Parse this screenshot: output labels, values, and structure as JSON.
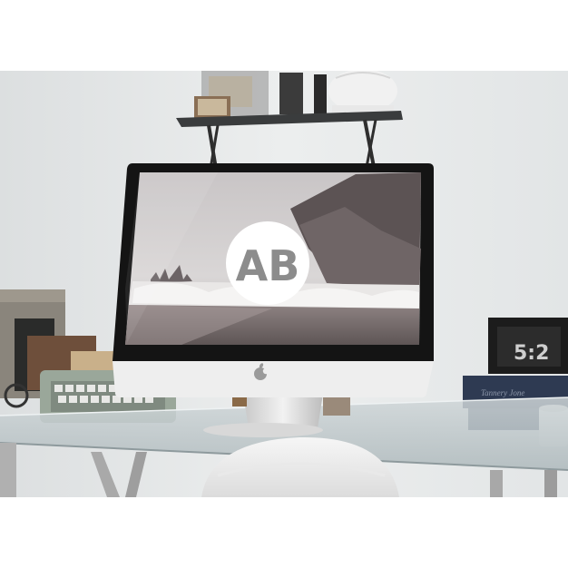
{
  "scene": {
    "description_tags": [
      "desk-photo",
      "imac-mockup"
    ],
    "screen_logo_text": "AB",
    "book_spine_text": "Tannery Jone",
    "clock_text": "5:2",
    "colors": {
      "wall": "#e4e6e6",
      "glass_desk": "#b8c2c4",
      "monitor_bezel": "#141414",
      "monitor_chin": "#eeeeee",
      "logo_circle": "#ffffff",
      "typewriter": "#9aa79a",
      "book_navy": "#2e3a52"
    }
  }
}
